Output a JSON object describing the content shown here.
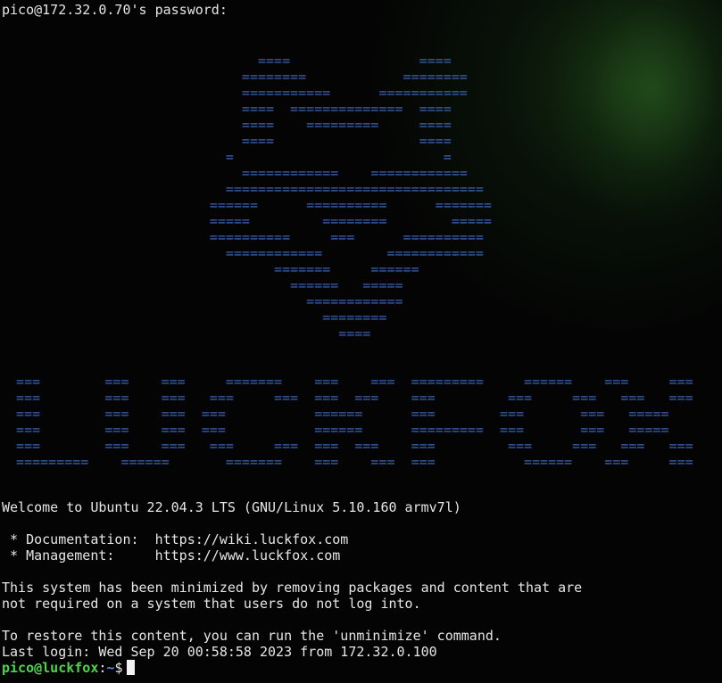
{
  "session": {
    "password_prompt": "pico@172.32.0.70's password:"
  },
  "ascii_logo": "                                ====                ====\n                              ========            ========\n                              ===========      ===========\n                              ====  ==============  ====\n                              ====    =========     ====\n                              ====                  ====\n                            =                          =\n                              ============    ============\n                            ================================\n                          ======      ==========      =======\n                          =====         ========        =====\n                          ==========     ===      ==========\n                            ============        ============\n                                  =======     ======\n                                    ======   =====\n                                      ============\n                                        ========\n                                          ====",
  "brand_banner": "  ===        ===    ===     =======    ===    ===  =========     ======    ===     ===\n  ===        ===    ===   ===     ===  ===  ===    ===         ===     ===   ===   ===\n  ===        ===    ===  ===           ======      ===        ===       ===   =====\n  ===        ===    ===  ===           ======      =========  ===       ===   =====\n  ===        ===    ===   ===     ===  ===  ===    ===         ===     ===   ===   ===\n  =========    ======       =======    ===    ===  ===           ======    ===     ===",
  "motd": {
    "welcome": "Welcome to Ubuntu 22.04.3 LTS (GNU/Linux 5.10.160 armv7l)",
    "documentation": " * Documentation:  https://wiki.luckfox.com",
    "management": " * Management:     https://www.luckfox.com",
    "minimized_1": "This system has been minimized by removing packages and content that are",
    "minimized_2": "not required on a system that users do not log into.",
    "restore": "To restore this content, you can run the 'unminimize' command.",
    "last_login": "Last login: Wed Sep 20 00:58:58 2023 from 172.32.0.100"
  },
  "prompt": {
    "user_host": "pico@luckfox",
    "separator": ":",
    "path": "~",
    "symbol": "$"
  },
  "colors": {
    "background": "#040404",
    "text": "#e6e6e6",
    "ascii_art": "#3d64b4",
    "prompt_user": "#4fd34f",
    "prompt_path": "#5b8ce8"
  }
}
